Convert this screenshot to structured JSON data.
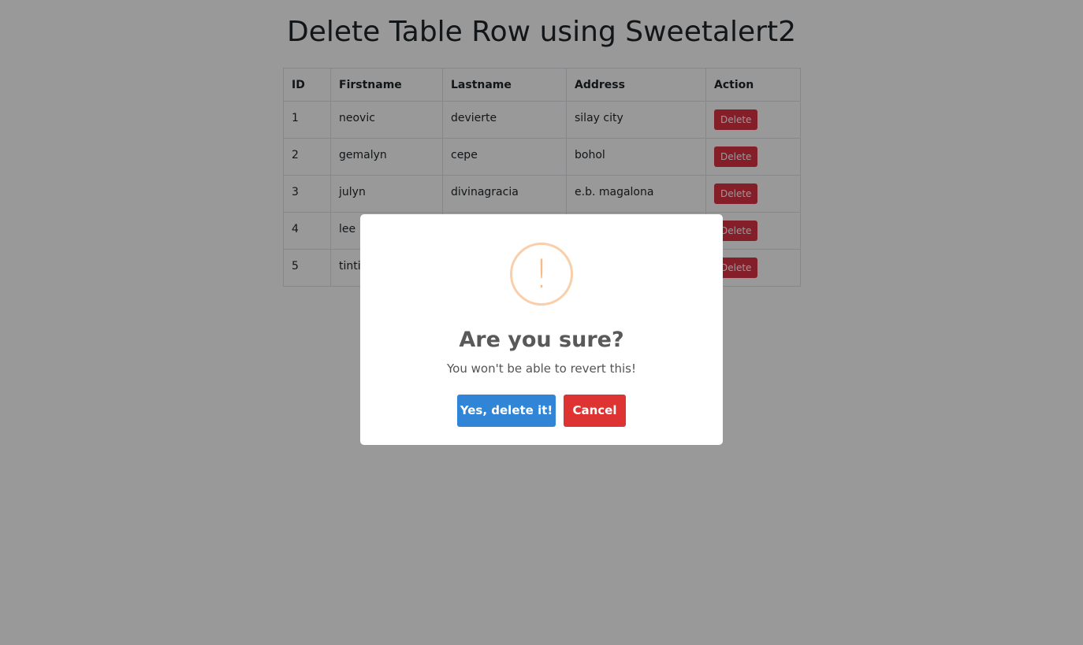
{
  "page": {
    "title": "Delete Table Row using Sweetalert2"
  },
  "table": {
    "headers": [
      "ID",
      "Firstname",
      "Lastname",
      "Address",
      "Action"
    ],
    "rows": [
      {
        "id": "1",
        "firstname": "neovic",
        "lastname": "devierte",
        "address": "silay city",
        "action": "Delete"
      },
      {
        "id": "2",
        "firstname": "gemalyn",
        "lastname": "cepe",
        "address": "bohol",
        "action": "Delete"
      },
      {
        "id": "3",
        "firstname": "julyn",
        "lastname": "divinagracia",
        "address": "e.b. magalona",
        "action": "Delete"
      },
      {
        "id": "4",
        "firstname": "lee",
        "lastname": "",
        "address": "",
        "action": "Delete"
      },
      {
        "id": "5",
        "firstname": "tinti",
        "lastname": "",
        "address": "",
        "action": "Delete"
      }
    ]
  },
  "dialog": {
    "icon": "warning-icon",
    "icon_glyph": "!",
    "title": "Are you sure?",
    "text": "You won't be able to revert this!",
    "confirm_label": "Yes, delete it!",
    "cancel_label": "Cancel"
  },
  "colors": {
    "confirm": "#3085d6",
    "cancel": "#dd3333",
    "delete": "#dc3545",
    "warning": "#f8bb86"
  }
}
